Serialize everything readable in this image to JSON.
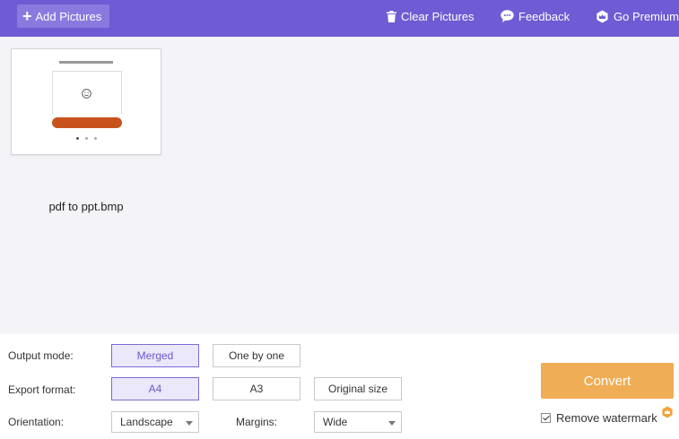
{
  "toolbar": {
    "add_label": "Add Pictures",
    "clear_label": "Clear Pictures",
    "feedback_label": "Feedback",
    "premium_label": "Go Premium"
  },
  "files": [
    {
      "name": "pdf to ppt.bmp"
    }
  ],
  "options": {
    "output_mode": {
      "label": "Output mode:",
      "choices": [
        "Merged",
        "One by one"
      ],
      "selected": "Merged"
    },
    "export_format": {
      "label": "Export format:",
      "choices": [
        "A4",
        "A3",
        "Original size"
      ],
      "selected": "A4"
    },
    "orientation": {
      "label": "Orientation:",
      "value": "Landscape"
    },
    "margins": {
      "label": "Margins:",
      "value": "Wide"
    }
  },
  "convert_label": "Convert",
  "watermark": {
    "label": "Remove watermark",
    "checked": true
  },
  "icons": {
    "add": "plus-icon",
    "clear": "trash-icon",
    "feedback": "chat-bubble-icon",
    "premium": "crown-badge-icon",
    "watermark_premium": "premium-badge-icon"
  },
  "colors": {
    "toolbar_bg": "#6f5bd3",
    "accent": "#6a5acd",
    "convert_bg": "#efad55",
    "workspace_bg": "#f4f4f8"
  }
}
